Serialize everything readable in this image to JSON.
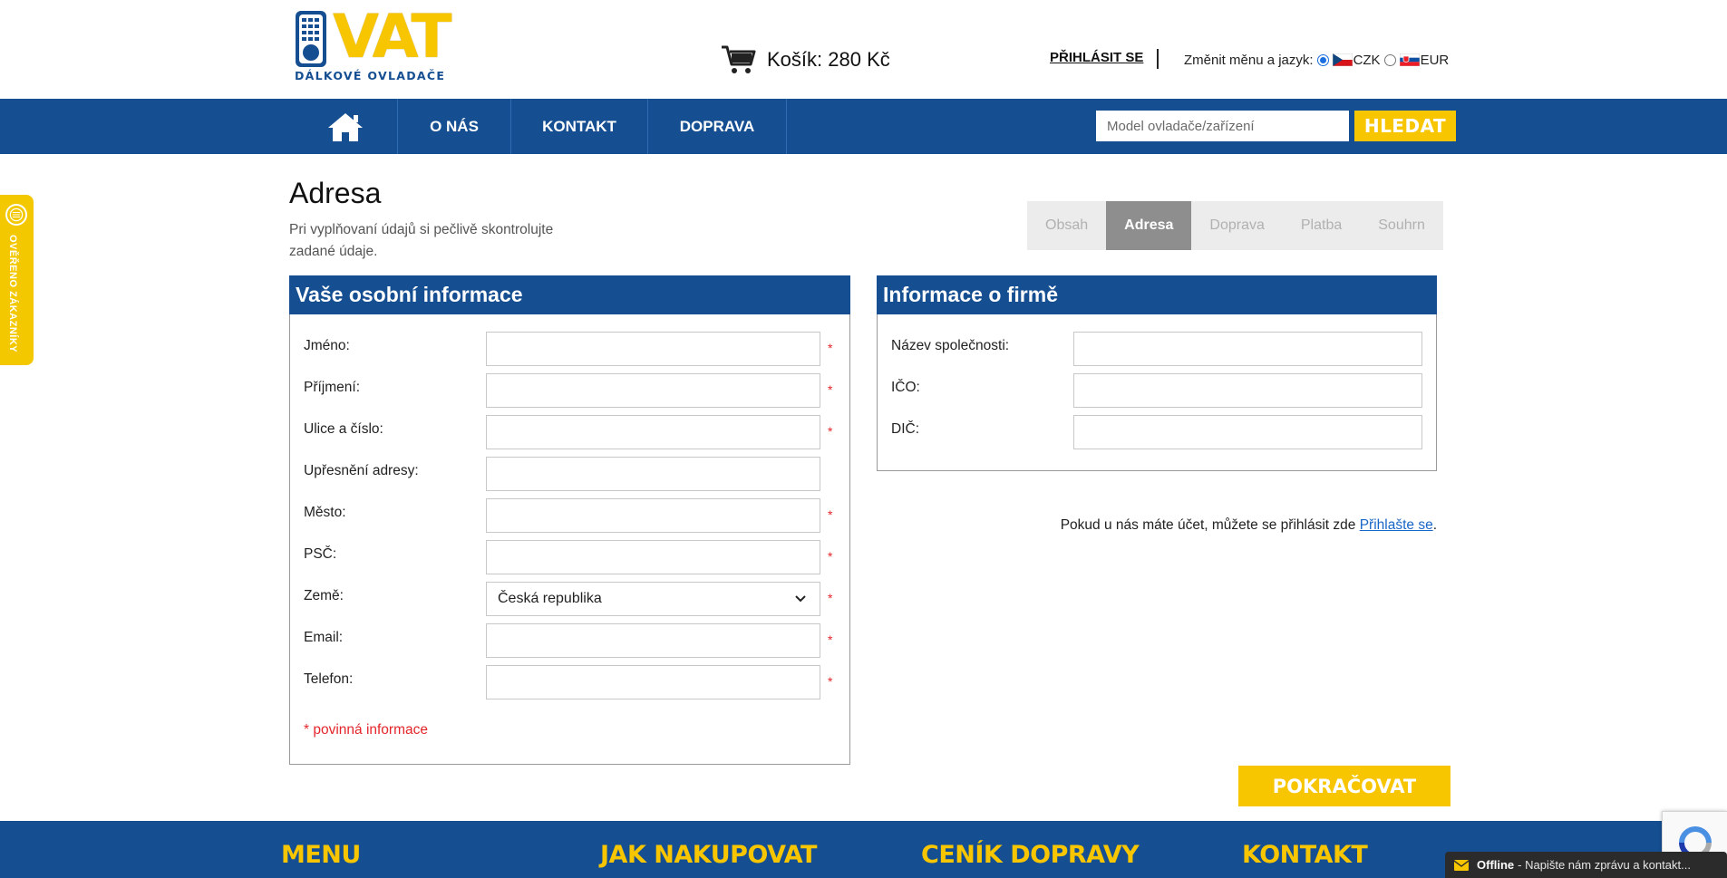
{
  "header": {
    "logo_text": "VAT",
    "logo_subtitle": "DÁLKOVÉ OVLADAČE",
    "cart_label": "Košík: 280 Kč",
    "login_label": "PŘIHLÁSIT SE",
    "currency_label": "Změnit měnu a jazyk:",
    "currency_options": [
      {
        "label": "CZK",
        "selected": true
      },
      {
        "label": "EUR",
        "selected": false
      }
    ]
  },
  "nav": {
    "items": [
      {
        "label": "O NÁS"
      },
      {
        "label": "KONTAKT"
      },
      {
        "label": "DOPRAVA"
      }
    ],
    "search_placeholder": "Model ovladače/zařízení",
    "search_button": "HLEDAT"
  },
  "side_tab": {
    "label": "OVĚŘENO ZÁKAZNÍKY"
  },
  "page": {
    "title": "Adresa",
    "subtitle": "Pri vyplňovaní údajů si pečlivě skontrolujte zadané údaje."
  },
  "steps": [
    {
      "label": "Obsah",
      "active": false
    },
    {
      "label": "Adresa",
      "active": true
    },
    {
      "label": "Doprava",
      "active": false
    },
    {
      "label": "Platba",
      "active": false
    },
    {
      "label": "Souhrn",
      "active": false
    }
  ],
  "personal": {
    "heading": "Vaše osobní informace",
    "fields": [
      {
        "label": "Jméno:",
        "value": "",
        "required": true
      },
      {
        "label": "Příjmení:",
        "value": "",
        "required": true
      },
      {
        "label": "Ulice a číslo:",
        "value": "",
        "required": true
      },
      {
        "label": "Upřesnění adresy:",
        "value": "",
        "required": false
      },
      {
        "label": "Město:",
        "value": "",
        "required": true
      },
      {
        "label": "PSČ:",
        "value": "",
        "required": true
      },
      {
        "label": "Země:",
        "value": "Česká republika",
        "required": true,
        "select": true
      },
      {
        "label": "Email:",
        "value": "",
        "required": true
      },
      {
        "label": "Telefon:",
        "value": "",
        "required": true
      }
    ],
    "required_mark": "*",
    "required_note": "* povinná informace"
  },
  "company": {
    "heading": "Informace o firmě",
    "fields": [
      {
        "label": "Název společnosti:",
        "value": ""
      },
      {
        "label": "IČO:",
        "value": ""
      },
      {
        "label": "DIČ:",
        "value": ""
      }
    ]
  },
  "login_note": {
    "text": "Pokud u nás máte účet, můžete se přihlásit zde ",
    "link": "Přihlašte se",
    "suffix": "."
  },
  "continue_button": "POKRAČOVAT",
  "footer": {
    "headings": [
      "MENU",
      "JAK NAKUPOVAT",
      "CENÍK DOPRAVY",
      "KONTAKT"
    ]
  },
  "chat": {
    "status": "Offline",
    "text": "- Napište nám zprávu a kontakt..."
  },
  "colors": {
    "brand_blue": "#154f92",
    "brand_yellow": "#f7c600",
    "required_red": "#e4262b",
    "link_blue": "#1a66c7"
  }
}
